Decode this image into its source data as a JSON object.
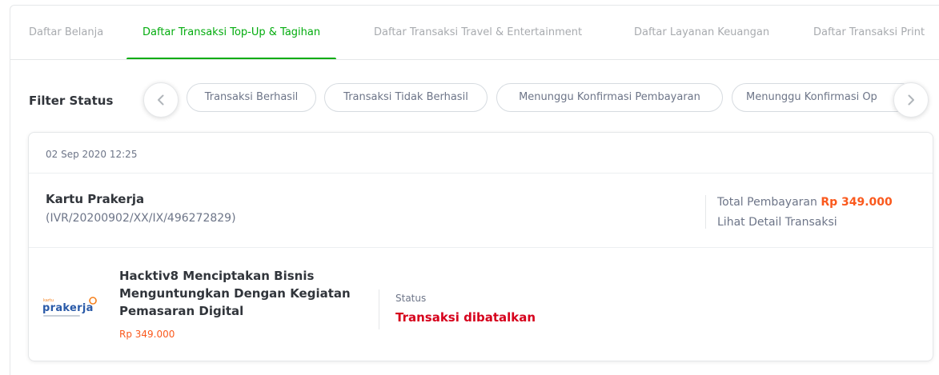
{
  "tabs": [
    {
      "label": "Daftar Belanja",
      "active": false
    },
    {
      "label": "Daftar Transaksi Top-Up & Tagihan",
      "active": true
    },
    {
      "label": "Daftar Transaksi Travel & Entertainment",
      "active": false
    },
    {
      "label": "Daftar Layanan Keuangan",
      "active": false
    },
    {
      "label": "Daftar Transaksi Print",
      "active": false
    }
  ],
  "filter": {
    "label": "Filter Status",
    "chips": [
      "Transaksi Berhasil",
      "Transaksi Tidak Berhasil",
      "Menunggu Konfirmasi Pembayaran",
      "Menunggu Konfirmasi Op"
    ],
    "prev_icon": "chevron-left-icon",
    "next_icon": "chevron-right-icon"
  },
  "transaction": {
    "date": "02 Sep 2020 12:25",
    "product_name": "Kartu Prakerja",
    "invoice": "(IVR/20200902/XX/IX/496272829)",
    "total_label": "Total Pembayaran",
    "total_amount": "Rp 349.000",
    "detail_link": "Lihat Detail Transaksi",
    "item": {
      "logo_icon": "kartu-prakerja-logo",
      "title": "Hacktiv8 Menciptakan Bisnis Menguntungkan Dengan Kegiatan Pemasaran Digital",
      "price": "Rp 349.000"
    },
    "status_label": "Status",
    "status_value": "Transaksi dibatalkan"
  },
  "colors": {
    "accent": "#03ac0e",
    "price": "#fa591d",
    "status_cancelled": "#d6001c",
    "logo_blue": "#2a5aa8"
  }
}
